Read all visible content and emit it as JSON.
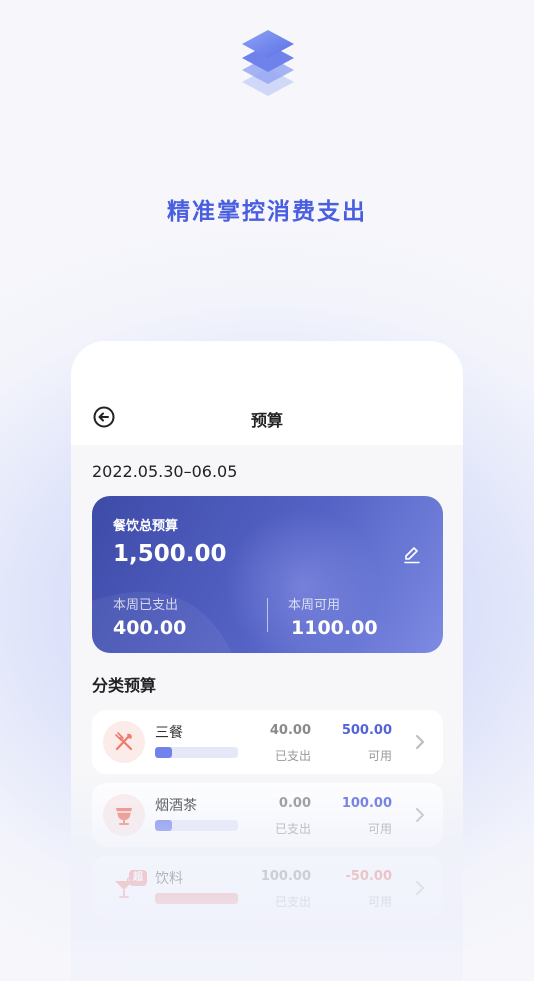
{
  "headline": "精准掌控消费支出",
  "nav": {
    "title": "预算"
  },
  "date_range": "2022.05.30–06.05",
  "budget_card": {
    "title": "餐饮总预算",
    "total": "1,500.00",
    "spent_label": "本周已支出",
    "spent_value": "400.00",
    "available_label": "本周可用",
    "available_value": "1100.00"
  },
  "section_title": "分类预算",
  "categories": [
    {
      "name": "三餐",
      "spent": "40.00",
      "spent_label": "已支出",
      "budget": "500.00",
      "budget_label": "可用",
      "progress": 0.2,
      "icon": "fork-knife-icon",
      "badge": ""
    },
    {
      "name": "烟酒茶",
      "spent": "0.00",
      "spent_label": "已支出",
      "budget": "100.00",
      "budget_label": "可用",
      "progress": 0.2,
      "icon": "tea-cup-icon",
      "badge": ""
    },
    {
      "name": "饮料",
      "spent": "100.00",
      "spent_label": "已支出",
      "budget": "-50.00",
      "budget_label": "可用",
      "progress": 1.0,
      "icon": "cocktail-icon",
      "badge": "超"
    }
  ],
  "colors": {
    "accent": "#4a5fe0",
    "card_start": "#3e4ba8",
    "card_end": "#7d8be3",
    "over": "#f07a7a"
  }
}
